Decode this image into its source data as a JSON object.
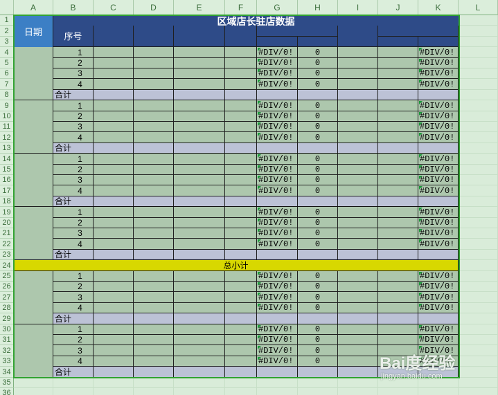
{
  "sheet": {
    "columns": [
      "A",
      "B",
      "C",
      "D",
      "E",
      "F",
      "G",
      "H",
      "I",
      "J",
      "K",
      "L"
    ],
    "rows": [
      "1",
      "2",
      "3",
      "4",
      "5",
      "6",
      "7",
      "8",
      "9",
      "10",
      "11",
      "12",
      "13",
      "14",
      "15",
      "16",
      "17",
      "18",
      "19",
      "20",
      "21",
      "22",
      "23",
      "24",
      "25",
      "26",
      "27",
      "28",
      "29",
      "30",
      "31",
      "32",
      "33",
      "34",
      "35",
      "36"
    ]
  },
  "table": {
    "title": "区域店长驻店数据",
    "date_header": "日期",
    "seq_header": "序号",
    "subtotal_label": "合计",
    "grand_subtotal_label": "总小计",
    "div_error": "#DIV/0!",
    "zero": "0",
    "seq_numbers": [
      "1",
      "2",
      "3",
      "4"
    ]
  },
  "watermark": {
    "brand": "Bai度经验",
    "url": "jingyan.baidu.com"
  }
}
